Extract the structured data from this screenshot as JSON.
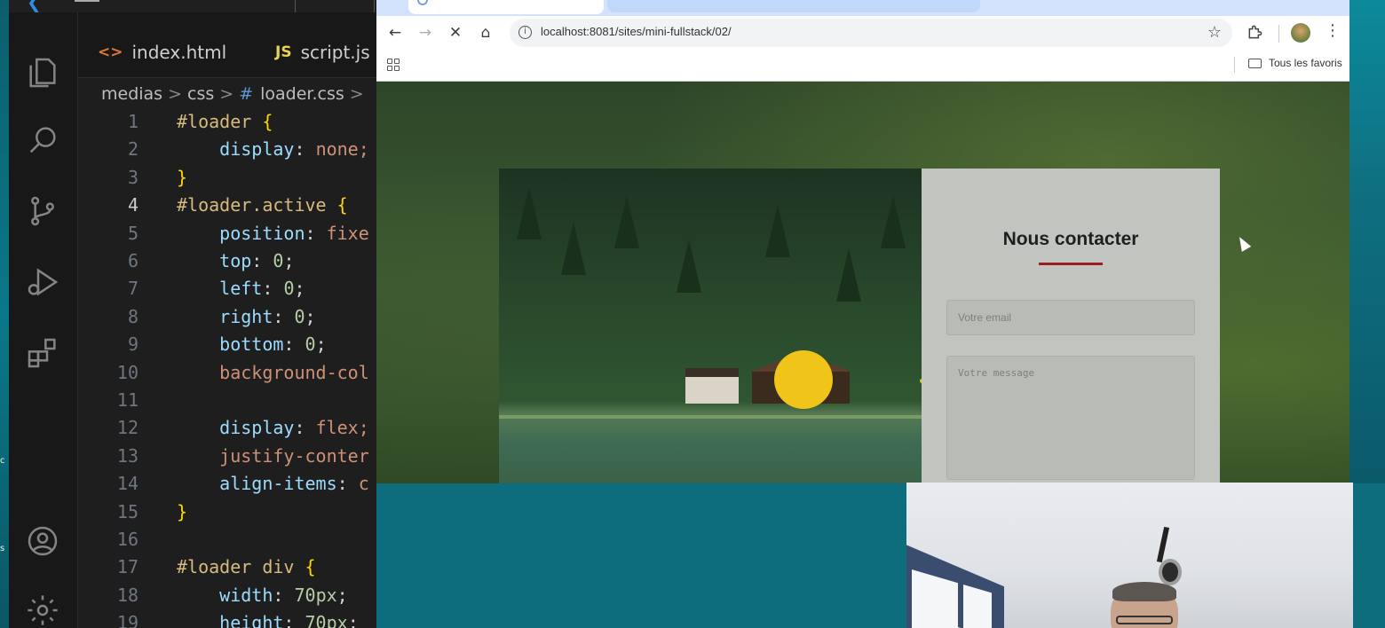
{
  "editor": {
    "tabs": [
      {
        "icon": "<>",
        "label": "index.html"
      },
      {
        "icon": "JS",
        "label": "script.js"
      }
    ],
    "breadcrumb": {
      "items": [
        "medias",
        "css",
        "loader.css"
      ],
      "hash_icon": "#",
      "separator": ">"
    },
    "current_line": 4,
    "lines": [
      {
        "n": "1",
        "text": "#loader {"
      },
      {
        "n": "2",
        "text": "    display: none;"
      },
      {
        "n": "3",
        "text": "}"
      },
      {
        "n": "4",
        "text": "#loader.active {"
      },
      {
        "n": "5",
        "text": "    position: fixe"
      },
      {
        "n": "6",
        "text": "    top: 0;"
      },
      {
        "n": "7",
        "text": "    left: 0;"
      },
      {
        "n": "8",
        "text": "    right: 0;"
      },
      {
        "n": "9",
        "text": "    bottom: 0;"
      },
      {
        "n": "10",
        "text": "    background-col"
      },
      {
        "n": "11",
        "text": ""
      },
      {
        "n": "12",
        "text": "    display: flex;"
      },
      {
        "n": "13",
        "text": "    justify-conter"
      },
      {
        "n": "14",
        "text": "    align-items: c"
      },
      {
        "n": "15",
        "text": "}"
      },
      {
        "n": "16",
        "text": ""
      },
      {
        "n": "17",
        "text": "#loader div {"
      },
      {
        "n": "18",
        "text": "    width: 70px;"
      },
      {
        "n": "19",
        "text": "    height: 70px;"
      }
    ],
    "activity_icons": [
      "explorer-icon",
      "search-icon",
      "source-control-icon",
      "run-debug-icon",
      "extensions-icon",
      "account-icon",
      "settings-gear-icon"
    ]
  },
  "browser": {
    "nav": {
      "back": "←",
      "forward": "→",
      "stop": "✕",
      "home": "⌂"
    },
    "url": "localhost:8081/sites/mini-fullstack/02/",
    "bookmark_star": "☆",
    "menu_icon": "⋮",
    "bookmarks_all": "Tous les favoris"
  },
  "page": {
    "form_title": "Nous contacter",
    "email_placeholder": "Votre email",
    "message_placeholder": "Votre message",
    "accent_color": "#9b1d1d",
    "loader_color": "#f0c419"
  }
}
